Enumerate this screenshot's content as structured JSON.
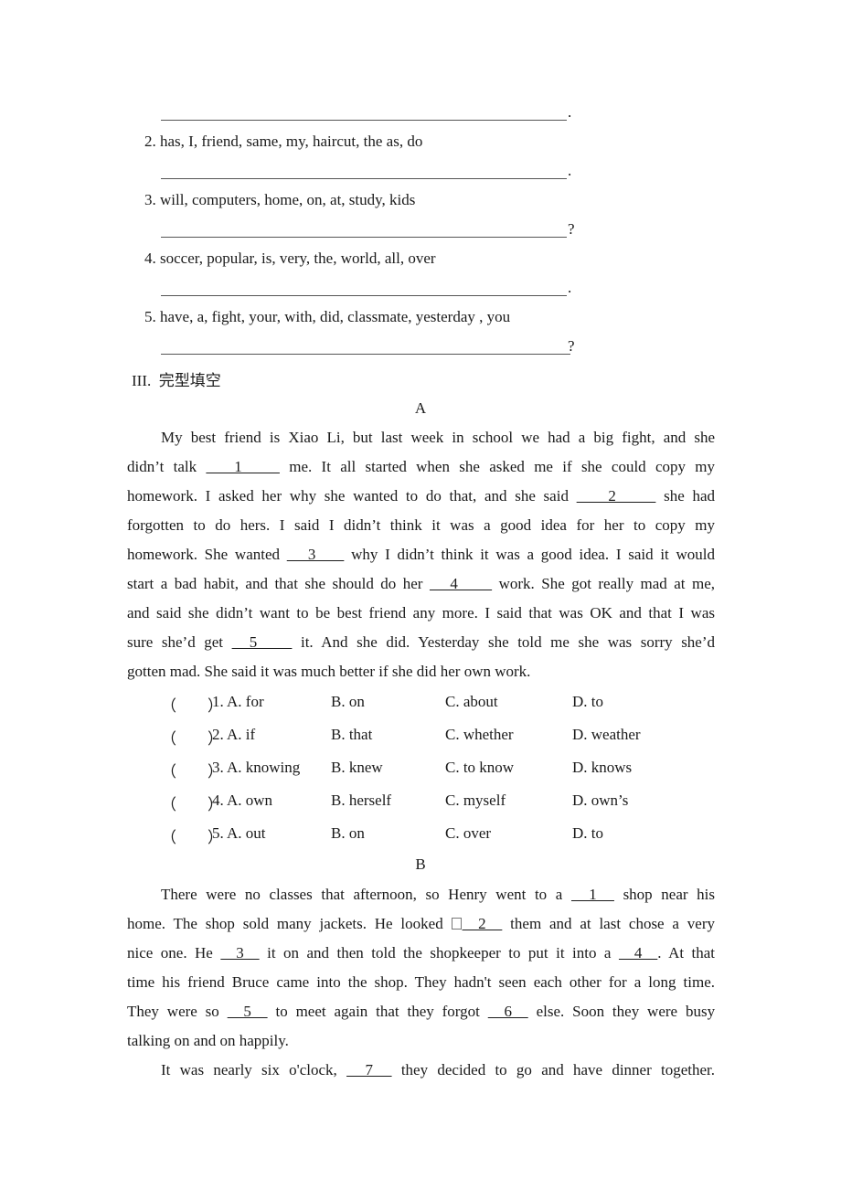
{
  "reorder": {
    "items": [
      {
        "number": "",
        "words": "",
        "end": "."
      },
      {
        "number": "2.",
        "words": "has, I, friend, same, my, haircut, the as, do",
        "end": "."
      },
      {
        "number": "3.",
        "words": "will, computers, home, on, at, study, kids",
        "end": "?"
      },
      {
        "number": "4.",
        "words": "soccer, popular, is, very, the, world, all, over",
        "end": "."
      },
      {
        "number": "5.",
        "words": "have, a, fight, your, with, did, classmate, yesterday , you",
        "end": "?"
      }
    ]
  },
  "section3": {
    "heading_num": "III.",
    "heading_text": "完型填空"
  },
  "passageA": {
    "label": "A",
    "lines": [
      [
        "My best friend is Xiao Li, but last week in school we had a big fight, and she"
      ],
      [
        "didn’t talk",
        "   1    ",
        "me. It all started when she asked me if she could copy my"
      ],
      [
        "homework. I asked her why she wanted to do that, and she said",
        "    2     ",
        "she had"
      ],
      [
        "forgotten to do hers. I said I didn’t think it was a good idea for her to copy my"
      ],
      [
        "homework. She wanted",
        "   3    ",
        "why I didn’t think it was a good idea. I said it would"
      ],
      [
        "start a bad habit, and that she should do her",
        "   4     ",
        "work. She got really mad at me,"
      ],
      [
        "and said she didn’t want to be best friend any more. I said that was OK and that I was"
      ],
      [
        "sure she’d get",
        "  5    ",
        " it. And she did. Yesterday she told me she was sorry she’d"
      ],
      [
        "gotten mad. She said it was much better if she did her own work."
      ]
    ],
    "options": [
      {
        "paren": "（　　）",
        "num": "1.",
        "A": "A. for",
        "B": "B. on",
        "C": "C. about",
        "D": "D. to"
      },
      {
        "paren": "（　　）",
        "num": "2.",
        "A": "A. if",
        "B": "B. that",
        "C": "C. whether",
        "D": "D. weather"
      },
      {
        "paren": "（　　）",
        "num": "3.",
        "A": "A. knowing",
        "B": "B. knew",
        "C": "C. to know",
        "D": "D. knows"
      },
      {
        "paren": "（　　）",
        "num": "4.",
        "A": "A. own",
        "B": "B. herself",
        "C": "C. myself",
        "D": "D. own’s"
      },
      {
        "paren": "（　　）",
        "num": "5.",
        "A": "A. out",
        "B": "B. on",
        "C": "C. over",
        "D": "D. to"
      }
    ]
  },
  "passageB": {
    "label": "B",
    "lines": [
      [
        "There were no classes that afternoon, so Henry went to a",
        "  1  ",
        "shop near his"
      ],
      [
        "home. The shop sold many jackets. He looked",
        "  2  ",
        "them and at last chose a very"
      ],
      [
        "nice one. He",
        "  3  ",
        "it on and then told the shopkeeper to put it into a",
        "  4  ",
        ". At that"
      ],
      [
        "time his friend Bruce came into the shop. They hadn't seen each other for a long time."
      ],
      [
        "They were so",
        "  5  ",
        "to meet again that they forgot",
        "  6  ",
        "else. Soon they were busy"
      ],
      [
        "talking on and on happily."
      ],
      [
        "It was nearly six o'clock,",
        "  7  ",
        "they decided to go and have dinner together."
      ]
    ]
  }
}
